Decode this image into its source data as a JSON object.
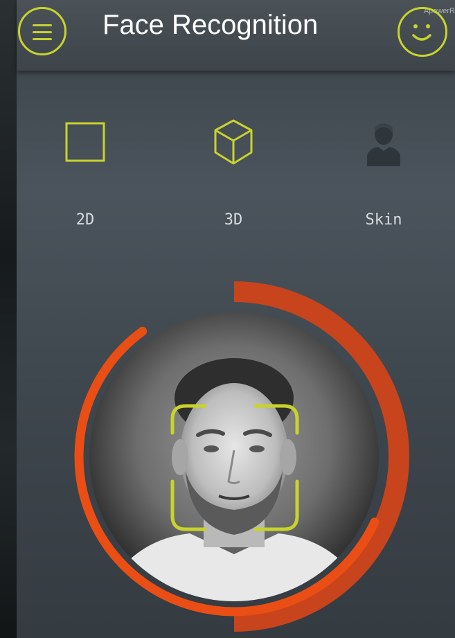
{
  "header": {
    "title": "Face Recognition",
    "menu_icon": "hamburger-menu-icon",
    "profile_icon": "smiley-face-icon",
    "watermark": "ApowerR"
  },
  "modes": [
    {
      "label": "2D",
      "icon": "square-icon"
    },
    {
      "label": "3D",
      "icon": "cube-icon"
    },
    {
      "label": "Skin",
      "icon": "person-icon"
    }
  ],
  "colors": {
    "accent": "#c9d32c",
    "progress_outer": "#c7441c",
    "progress_inner": "#ea4e14",
    "label": "#d8dcdf"
  },
  "scanner": {
    "outer_progress": 0.5,
    "inner_progress": 0.58
  }
}
